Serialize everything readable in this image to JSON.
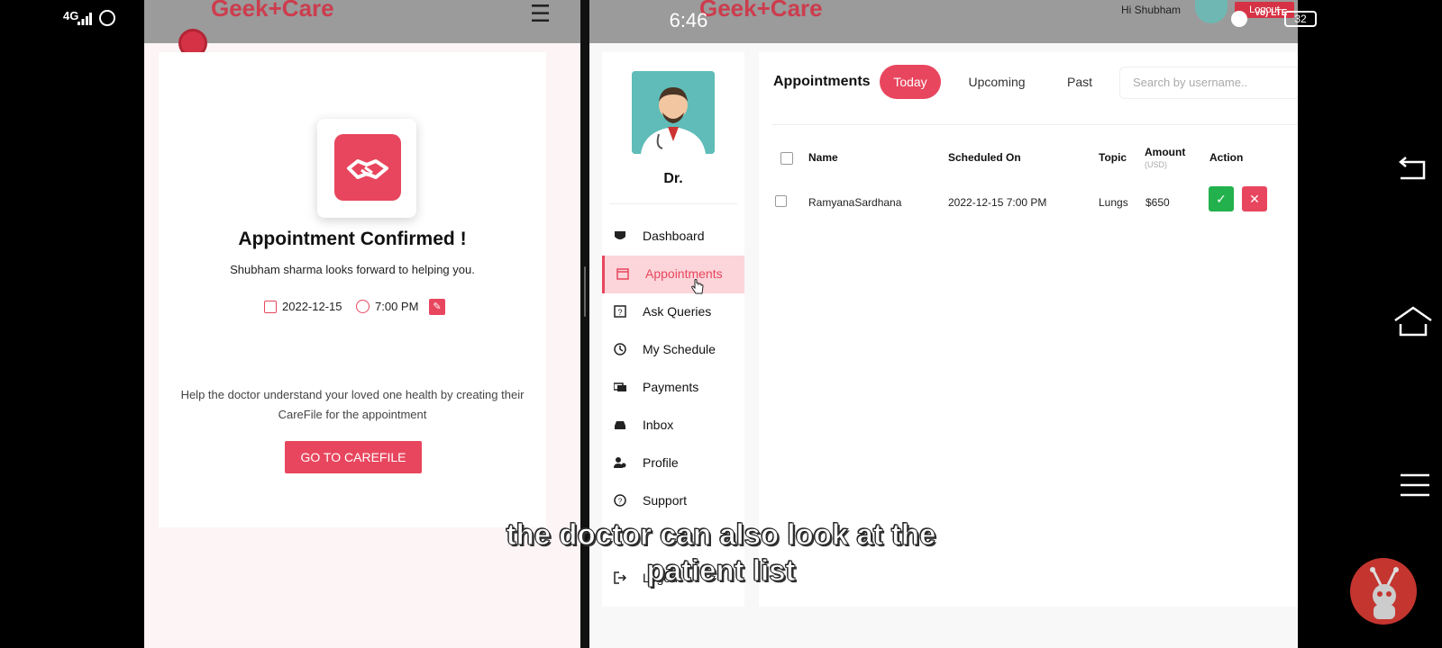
{
  "status_bar": {
    "network": "4G",
    "time": "6:46",
    "volte": "Vo) LTE",
    "battery": "32"
  },
  "patient_app": {
    "logo": "Geek+Care",
    "confirmation": {
      "title": "Appointment Confirmed !",
      "subtitle": "Shubham sharma looks forward to helping you.",
      "date": "2022-12-15",
      "time": "7:00 PM",
      "help_text": "Help the doctor understand your loved one health by creating their CareFile for the appointment",
      "button": "GO TO CAREFILE"
    }
  },
  "doctor_app": {
    "logo": "Geek+Care",
    "greeting": "Hi Shubham",
    "logout_label": "Logout",
    "doctor_name": "Dr.",
    "nav": [
      {
        "label": "Dashboard",
        "icon": "dashboard-icon"
      },
      {
        "label": "Appointments",
        "icon": "calendar-icon",
        "active": true
      },
      {
        "label": "Ask Queries",
        "icon": "question-icon"
      },
      {
        "label": "My Schedule",
        "icon": "clock-icon"
      },
      {
        "label": "Payments",
        "icon": "money-icon"
      },
      {
        "label": "Inbox",
        "icon": "inbox-icon"
      },
      {
        "label": "Profile",
        "icon": "user-icon"
      },
      {
        "label": "Support",
        "icon": "help-icon"
      },
      {
        "label": "Logout",
        "icon": "logout-icon"
      }
    ],
    "appointments": {
      "title": "Appointments",
      "tabs": [
        "Today",
        "Upcoming",
        "Past"
      ],
      "active_tab": "Today",
      "search_placeholder": "Search by username..",
      "columns": [
        "Name",
        "Scheduled On",
        "Topic",
        "Amount",
        "Action"
      ],
      "amount_unit": "(USD)",
      "rows": [
        {
          "name": "RamyanaSardhana",
          "scheduled": "2022-12-15 7:00 PM",
          "topic": "Lungs",
          "amount": "$650"
        }
      ]
    }
  },
  "caption": [
    "the doctor can also look at the",
    "patient list"
  ],
  "colors": {
    "accent": "#e8465e",
    "approve": "#22b14c"
  }
}
